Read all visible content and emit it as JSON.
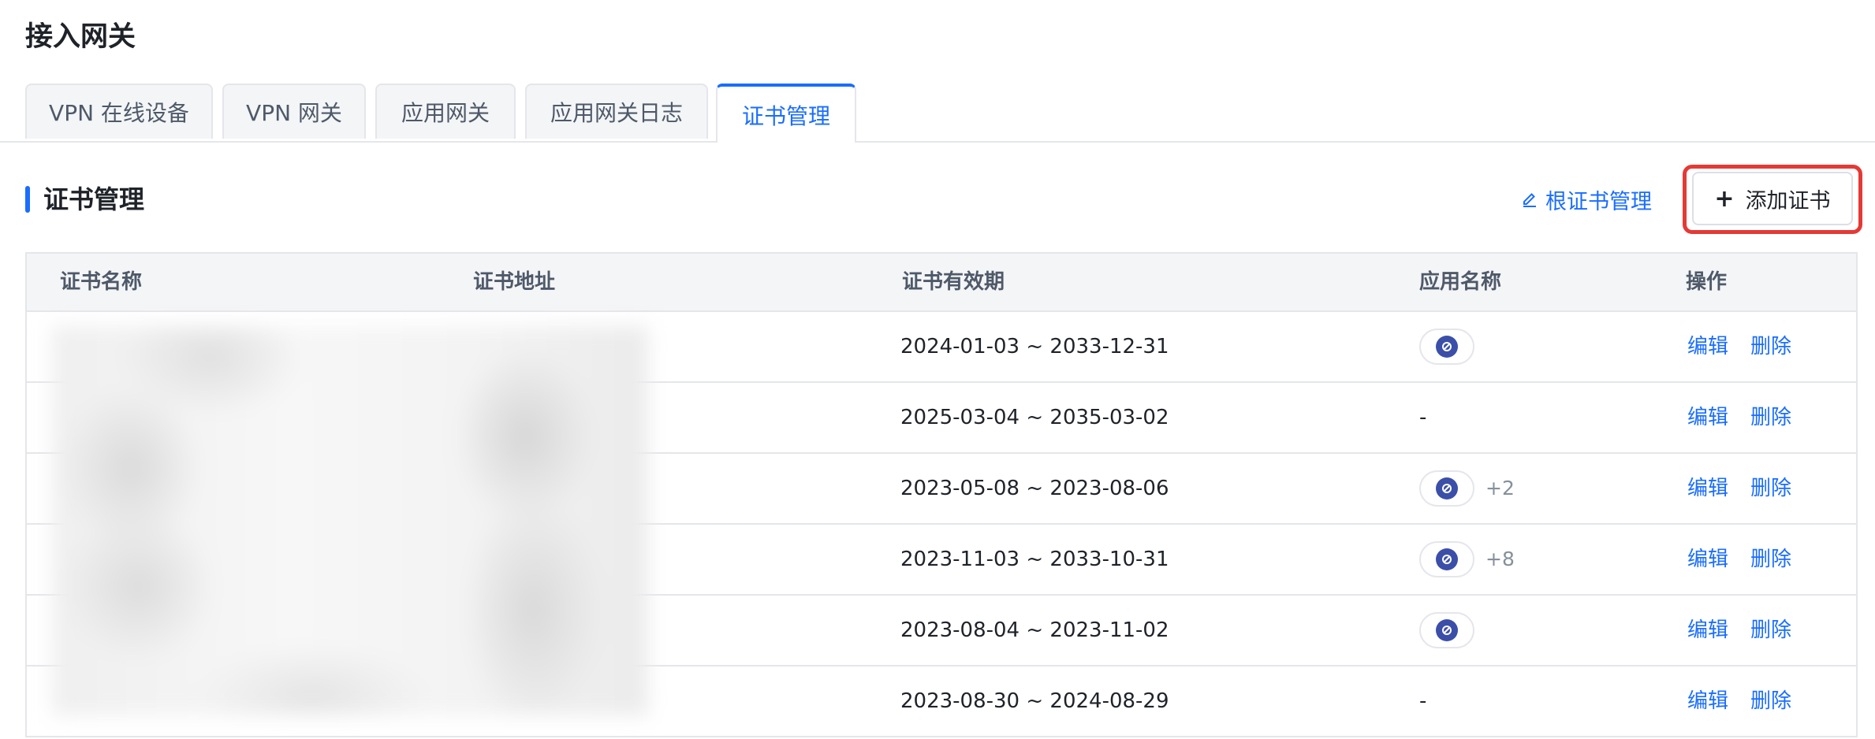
{
  "header": {
    "title": "接入网关"
  },
  "tabs": [
    {
      "label": "VPN 在线设备"
    },
    {
      "label": "VPN 网关"
    },
    {
      "label": "应用网关"
    },
    {
      "label": "应用网关日志"
    },
    {
      "label": "证书管理",
      "active": true
    }
  ],
  "section": {
    "title": "证书管理",
    "root_cert_link": "根证书管理",
    "add_button": {
      "icon": "plus-icon",
      "label": "添加证书"
    }
  },
  "table": {
    "columns": [
      "证书名称",
      "证书地址",
      "证书有效期",
      "应用名称",
      "操作"
    ],
    "rows": [
      {
        "validity": "2024-01-03 ~ 2033-12-31",
        "apps": {
          "chip": true,
          "more": ""
        },
        "edit": "编辑",
        "delete": "删除"
      },
      {
        "validity": "2025-03-04 ~ 2035-03-02",
        "apps": {
          "chip": false,
          "text": "-"
        },
        "edit": "编辑",
        "delete": "删除"
      },
      {
        "validity": "2023-05-08 ~ 2023-08-06",
        "apps": {
          "chip": true,
          "more": "+2"
        },
        "edit": "编辑",
        "delete": "删除"
      },
      {
        "validity": "2023-11-03 ~ 2033-10-31",
        "apps": {
          "chip": true,
          "more": "+8"
        },
        "edit": "编辑",
        "delete": "删除"
      },
      {
        "validity": "2023-08-04 ~ 2023-11-02",
        "apps": {
          "chip": true,
          "more": ""
        },
        "edit": "编辑",
        "delete": "删除"
      },
      {
        "validity": "2023-08-30 ~ 2024-08-29",
        "apps": {
          "chip": false,
          "text": "-"
        },
        "edit": "编辑",
        "delete": "删除"
      }
    ]
  },
  "colors": {
    "accent": "#1a6dff",
    "highlight": "#e53935",
    "app_icon": "#3b4fa8"
  }
}
